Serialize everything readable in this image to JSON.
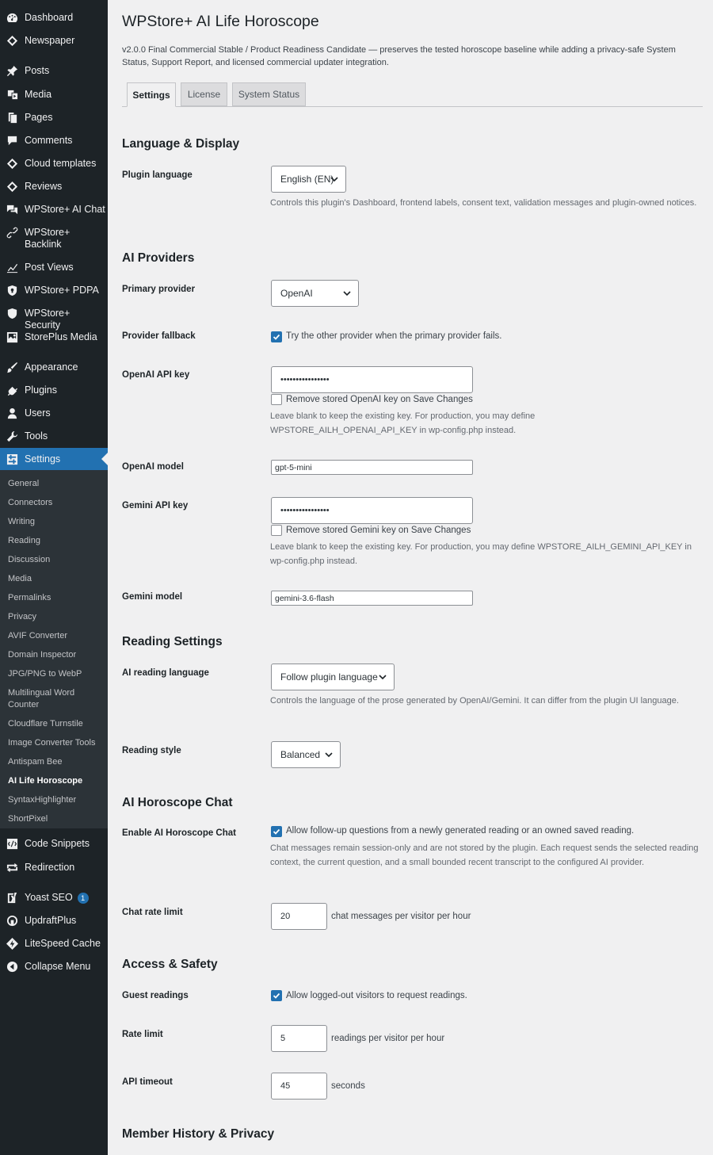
{
  "sidebar": {
    "items": [
      {
        "label": "Dashboard",
        "icon": "dashboard-icon"
      },
      {
        "label": "Newspaper",
        "icon": "newspaper-diamond-icon"
      },
      {
        "label": "Posts",
        "icon": "pin-icon"
      },
      {
        "label": "Media",
        "icon": "media-icon"
      },
      {
        "label": "Pages",
        "icon": "pages-icon"
      },
      {
        "label": "Comments",
        "icon": "comment-icon"
      },
      {
        "label": "Cloud templates",
        "icon": "diamond-icon"
      },
      {
        "label": "Reviews",
        "icon": "diamond-icon"
      },
      {
        "label": "WPStore+ AI Chat",
        "icon": "chat-icon"
      },
      {
        "label": "WPStore+ Backlink",
        "icon": "link-icon"
      },
      {
        "label": "Post Views",
        "icon": "chart-icon"
      },
      {
        "label": "WPStore+ PDPA",
        "icon": "shield-icon"
      },
      {
        "label": "WPStore+ Security",
        "icon": "shield-icon"
      },
      {
        "label": "StorePlus Media",
        "icon": "gallery-icon"
      },
      {
        "label": "Appearance",
        "icon": "brush-icon"
      },
      {
        "label": "Plugins",
        "icon": "plugin-icon"
      },
      {
        "label": "Users",
        "icon": "user-icon"
      },
      {
        "label": "Tools",
        "icon": "wrench-icon"
      },
      {
        "label": "Settings",
        "icon": "settings-icon"
      }
    ],
    "submenu": [
      "General",
      "Connectors",
      "Writing",
      "Reading",
      "Discussion",
      "Media",
      "Permalinks",
      "Privacy",
      "AVIF Converter",
      "Domain Inspector",
      "JPG/PNG to WebP",
      "Multilingual Word Counter",
      "Cloudflare Turnstile",
      "Image Converter Tools",
      "Antispam Bee",
      "AI Life Horoscope",
      "SyntaxHighlighter",
      "ShortPixel"
    ],
    "bottom_items": [
      {
        "label": "Code Snippets",
        "icon": "code-icon"
      },
      {
        "label": "Redirection",
        "icon": "redirect-icon"
      },
      {
        "label": "Yoast SEO",
        "icon": "yoast-icon",
        "badge": "1"
      },
      {
        "label": "UpdraftPlus",
        "icon": "updraft-icon"
      },
      {
        "label": "LiteSpeed Cache",
        "icon": "litespeed-icon"
      },
      {
        "label": "Collapse Menu",
        "icon": "collapse-icon"
      }
    ]
  },
  "page": {
    "title": "WPStore+ AI Life Horoscope",
    "description": "v2.0.0 Final Commercial Stable / Product Readiness Candidate — preserves the tested horoscope baseline while adding a privacy-safe System Status, Support Report, and licensed commercial updater integration.",
    "tabs": [
      "Settings",
      "License",
      "System Status"
    ]
  },
  "sections": {
    "language": {
      "title": "Language & Display",
      "plugin_language_label": "Plugin language",
      "plugin_language_value": "English (EN)",
      "plugin_language_help": "Controls this plugin's Dashboard, frontend labels, consent text, validation messages and plugin-owned notices."
    },
    "providers": {
      "title": "AI Providers",
      "primary_label": "Primary provider",
      "primary_value": "OpenAI",
      "fallback_label": "Provider fallback",
      "fallback_text": "Try the other provider when the primary provider fails.",
      "openai_key_label": "OpenAI API key",
      "openai_key_value": "••••••••••••••••",
      "openai_remove_text": "Remove stored OpenAI key on Save Changes",
      "openai_help": "Leave blank to keep the existing key. For production, you may define WPSTORE_AILH_OPENAI_API_KEY in wp-config.php instead.",
      "openai_model_label": "OpenAI model",
      "openai_model_value": "gpt-5-mini",
      "gemini_key_label": "Gemini API key",
      "gemini_key_value": "••••••••••••••••",
      "gemini_remove_text": "Remove stored Gemini key on Save Changes",
      "gemini_help": "Leave blank to keep the existing key. For production, you may define WPSTORE_AILH_GEMINI_API_KEY in wp-config.php instead.",
      "gemini_model_label": "Gemini model",
      "gemini_model_value": "gemini-3.6-flash"
    },
    "reading": {
      "title": "Reading Settings",
      "language_label": "AI reading language",
      "language_value": "Follow plugin language",
      "language_help": "Controls the language of the prose generated by OpenAI/Gemini. It can differ from the plugin UI language.",
      "style_label": "Reading style",
      "style_value": "Balanced"
    },
    "chat": {
      "title": "AI Horoscope Chat",
      "enable_label": "Enable AI Horoscope Chat",
      "enable_text": "Allow follow-up questions from a newly generated reading or an owned saved reading.",
      "enable_help": "Chat messages remain session-only and are not stored by the plugin. Each request sends the selected reading context, the current question, and a small bounded recent transcript to the configured AI provider.",
      "rate_label": "Chat rate limit",
      "rate_value": "20",
      "rate_suffix": "chat messages per visitor per hour"
    },
    "access": {
      "title": "Access & Safety",
      "guest_label": "Guest readings",
      "guest_text": "Allow logged-out visitors to request readings.",
      "rate_label": "Rate limit",
      "rate_value": "5",
      "rate_suffix": "readings per visitor per hour",
      "timeout_label": "API timeout",
      "timeout_value": "45",
      "timeout_suffix": "seconds"
    },
    "member": {
      "title": "Member History & Privacy"
    }
  },
  "colors": {
    "sidebar_bg": "#1d2327",
    "submenu_bg": "#2c3338",
    "accent": "#2271b1",
    "page_bg": "#f0f0f1"
  }
}
